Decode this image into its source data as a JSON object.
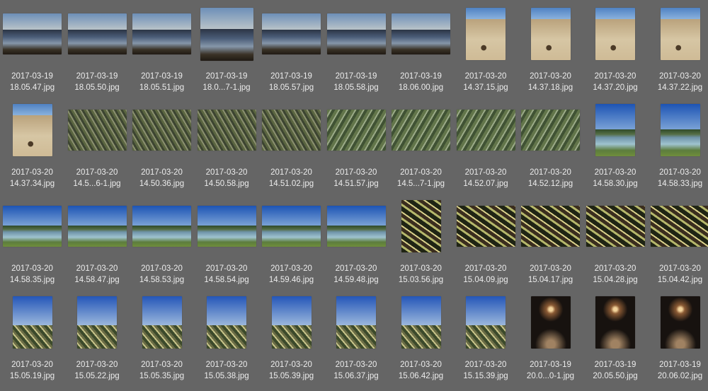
{
  "photos": [
    {
      "date": "2017-03-19",
      "name": "18.05.47.jpg",
      "scene": "sea",
      "shape": "land"
    },
    {
      "date": "2017-03-19",
      "name": "18.05.50.jpg",
      "scene": "sea",
      "shape": "land"
    },
    {
      "date": "2017-03-19",
      "name": "18.05.51.jpg",
      "scene": "sea",
      "shape": "land"
    },
    {
      "date": "2017-03-19",
      "name": "18.0...7-1.jpg",
      "scene": "sea",
      "shape": "square"
    },
    {
      "date": "2017-03-19",
      "name": "18.05.57.jpg",
      "scene": "sea",
      "shape": "land"
    },
    {
      "date": "2017-03-19",
      "name": "18.05.58.jpg",
      "scene": "sea",
      "shape": "land"
    },
    {
      "date": "2017-03-19",
      "name": "18.06.00.jpg",
      "scene": "sea",
      "shape": "land"
    },
    {
      "date": "2017-03-20",
      "name": "14.37.15.jpg",
      "scene": "sand",
      "shape": "port"
    },
    {
      "date": "2017-03-20",
      "name": "14.37.18.jpg",
      "scene": "sand",
      "shape": "port"
    },
    {
      "date": "2017-03-20",
      "name": "14.37.20.jpg",
      "scene": "sand",
      "shape": "port"
    },
    {
      "date": "2017-03-20",
      "name": "14.37.22.jpg",
      "scene": "sand",
      "shape": "port"
    },
    {
      "date": "2017-03-20",
      "name": "14.37.34.jpg",
      "scene": "sand",
      "shape": "port"
    },
    {
      "date": "2017-03-20",
      "name": "14.5...6-1.jpg",
      "scene": "brush",
      "shape": "land"
    },
    {
      "date": "2017-03-20",
      "name": "14.50.36.jpg",
      "scene": "brush",
      "shape": "land"
    },
    {
      "date": "2017-03-20",
      "name": "14.50.58.jpg",
      "scene": "brush",
      "shape": "land"
    },
    {
      "date": "2017-03-20",
      "name": "14.51.02.jpg",
      "scene": "brush",
      "shape": "land"
    },
    {
      "date": "2017-03-20",
      "name": "14.51.57.jpg",
      "scene": "plants",
      "shape": "land"
    },
    {
      "date": "2017-03-20",
      "name": "14.5...7-1.jpg",
      "scene": "plants",
      "shape": "land"
    },
    {
      "date": "2017-03-20",
      "name": "14.52.07.jpg",
      "scene": "plants",
      "shape": "land"
    },
    {
      "date": "2017-03-20",
      "name": "14.52.12.jpg",
      "scene": "plants",
      "shape": "land"
    },
    {
      "date": "2017-03-20",
      "name": "14.58.30.jpg",
      "scene": "pool",
      "shape": "port"
    },
    {
      "date": "2017-03-20",
      "name": "14.58.33.jpg",
      "scene": "pool",
      "shape": "port"
    },
    {
      "date": "2017-03-20",
      "name": "14.58.35.jpg",
      "scene": "pool",
      "shape": "land"
    },
    {
      "date": "2017-03-20",
      "name": "14.58.47.jpg",
      "scene": "pool",
      "shape": "land"
    },
    {
      "date": "2017-03-20",
      "name": "14.58.53.jpg",
      "scene": "pool",
      "shape": "land"
    },
    {
      "date": "2017-03-20",
      "name": "14.58.54.jpg",
      "scene": "pool",
      "shape": "land"
    },
    {
      "date": "2017-03-20",
      "name": "14.59.46.jpg",
      "scene": "pool",
      "shape": "land"
    },
    {
      "date": "2017-03-20",
      "name": "14.59.48.jpg",
      "scene": "pool",
      "shape": "land"
    },
    {
      "date": "2017-03-20",
      "name": "15.03.56.jpg",
      "scene": "agave",
      "shape": "port"
    },
    {
      "date": "2017-03-20",
      "name": "15.04.09.jpg",
      "scene": "agave",
      "shape": "land"
    },
    {
      "date": "2017-03-20",
      "name": "15.04.17.jpg",
      "scene": "agave",
      "shape": "land"
    },
    {
      "date": "2017-03-20",
      "name": "15.04.28.jpg",
      "scene": "agave",
      "shape": "land"
    },
    {
      "date": "2017-03-20",
      "name": "15.04.42.jpg",
      "scene": "agave",
      "shape": "land"
    },
    {
      "date": "2017-03-20",
      "name": "15.05.19.jpg",
      "scene": "agavesky",
      "shape": "port"
    },
    {
      "date": "2017-03-20",
      "name": "15.05.22.jpg",
      "scene": "agavesky",
      "shape": "port"
    },
    {
      "date": "2017-03-20",
      "name": "15.05.35.jpg",
      "scene": "agavesky",
      "shape": "port"
    },
    {
      "date": "2017-03-20",
      "name": "15.05.38.jpg",
      "scene": "agavesky",
      "shape": "port"
    },
    {
      "date": "2017-03-20",
      "name": "15.05.39.jpg",
      "scene": "agavesky",
      "shape": "port"
    },
    {
      "date": "2017-03-20",
      "name": "15.06.37.jpg",
      "scene": "agavesky",
      "shape": "port"
    },
    {
      "date": "2017-03-20",
      "name": "15.06.42.jpg",
      "scene": "agavesky",
      "shape": "port"
    },
    {
      "date": "2017-03-20",
      "name": "15.15.39.jpg",
      "scene": "agavesky",
      "shape": "port"
    },
    {
      "date": "2017-03-19",
      "name": "20.0...0-1.jpg",
      "scene": "night",
      "shape": "port"
    },
    {
      "date": "2017-03-19",
      "name": "20.05.50.jpg",
      "scene": "night",
      "shape": "port"
    },
    {
      "date": "2017-03-19",
      "name": "20.06.02.jpg",
      "scene": "night",
      "shape": "port"
    }
  ]
}
